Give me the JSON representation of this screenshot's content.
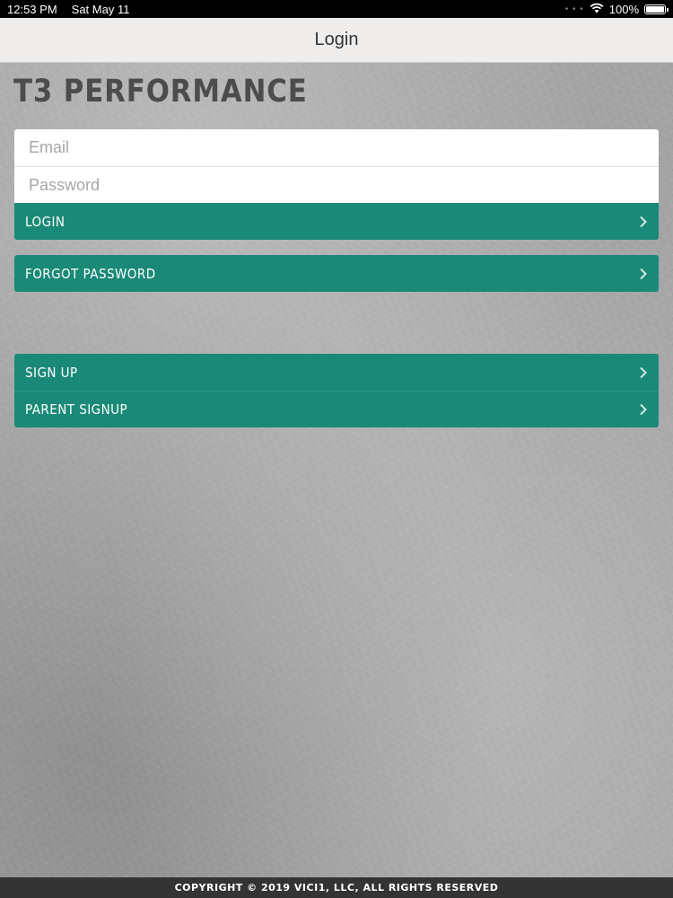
{
  "status_bar": {
    "time": "12:53 PM",
    "date": "Sat May 11",
    "battery": "100%",
    "wifi_icon": "wifi-icon",
    "battery_icon": "battery-icon"
  },
  "nav": {
    "title": "Login"
  },
  "brand": {
    "name": "T3 PERFORMANCE"
  },
  "login_form": {
    "email_placeholder": "Email",
    "email_value": "",
    "password_placeholder": "Password",
    "password_value": "",
    "login_label": "LOGIN"
  },
  "forgot": {
    "label": "FORGOT PASSWORD"
  },
  "signup": {
    "signup_label": "SIGN UP",
    "parent_signup_label": "PARENT SIGNUP"
  },
  "footer": {
    "copyright": "COPYRIGHT © 2019 VICI1, LLC, ALL RIGHTS RESERVED"
  },
  "icons": {
    "row_arrow": "chevron-right-icon"
  },
  "colors": {
    "accent": "#1a8977",
    "nav_bg": "#eeedec",
    "footer_bg": "#343434",
    "brand_text": "#4a4c4e"
  }
}
